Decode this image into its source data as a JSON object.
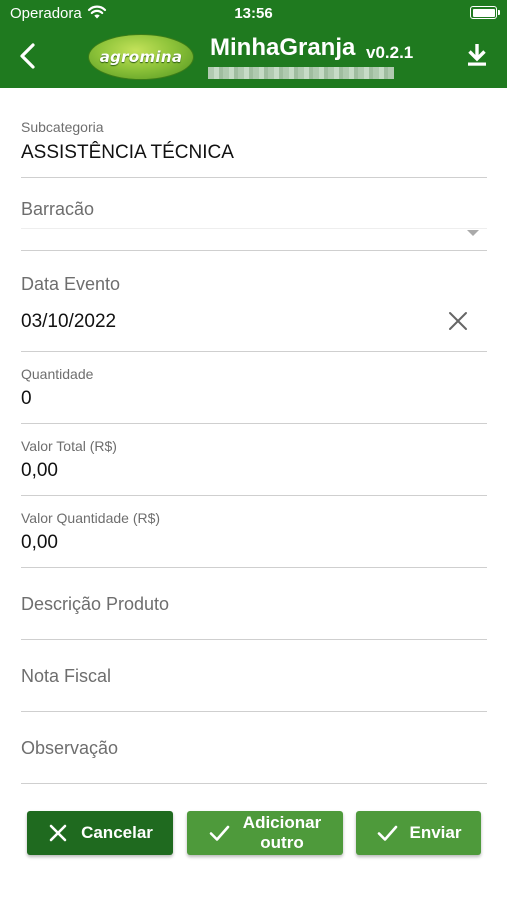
{
  "status_bar": {
    "carrier": "Operadora",
    "time": "13:56"
  },
  "header": {
    "logo_text": "agromina",
    "title": "MinhaGranja",
    "version": "v0.2.1"
  },
  "form": {
    "subcategoria": {
      "label": "Subcategoria",
      "value": "ASSISTÊNCIA TÉCNICA"
    },
    "barracao": {
      "label": "Barracão",
      "value": ""
    },
    "data_evento": {
      "label": "Data Evento",
      "value": "03/10/2022"
    },
    "quantidade": {
      "label": "Quantidade",
      "value": "0"
    },
    "valor_total": {
      "label": "Valor Total (R$)",
      "value": "0,00"
    },
    "valor_quantidade": {
      "label": "Valor Quantidade (R$)",
      "value": "0,00"
    },
    "descricao_produto": {
      "label": "Descrição Produto",
      "value": ""
    },
    "nota_fiscal": {
      "label": "Nota Fiscal",
      "value": ""
    },
    "observacao": {
      "label": "Observação",
      "value": ""
    }
  },
  "actions": {
    "cancel_label": "Cancelar",
    "add_label": "Adicionar outro",
    "send_label": "Enviar"
  },
  "colors": {
    "header_bg": "#1f7a1f",
    "cancel_bg": "#1f6a1f",
    "button_bg": "#4e9a3b"
  },
  "icons": [
    "wifi-icon",
    "battery-icon",
    "back-arrow-icon",
    "download-icon",
    "clear-x-icon",
    "dropdown-arrow-icon",
    "close-icon",
    "check-icon"
  ]
}
